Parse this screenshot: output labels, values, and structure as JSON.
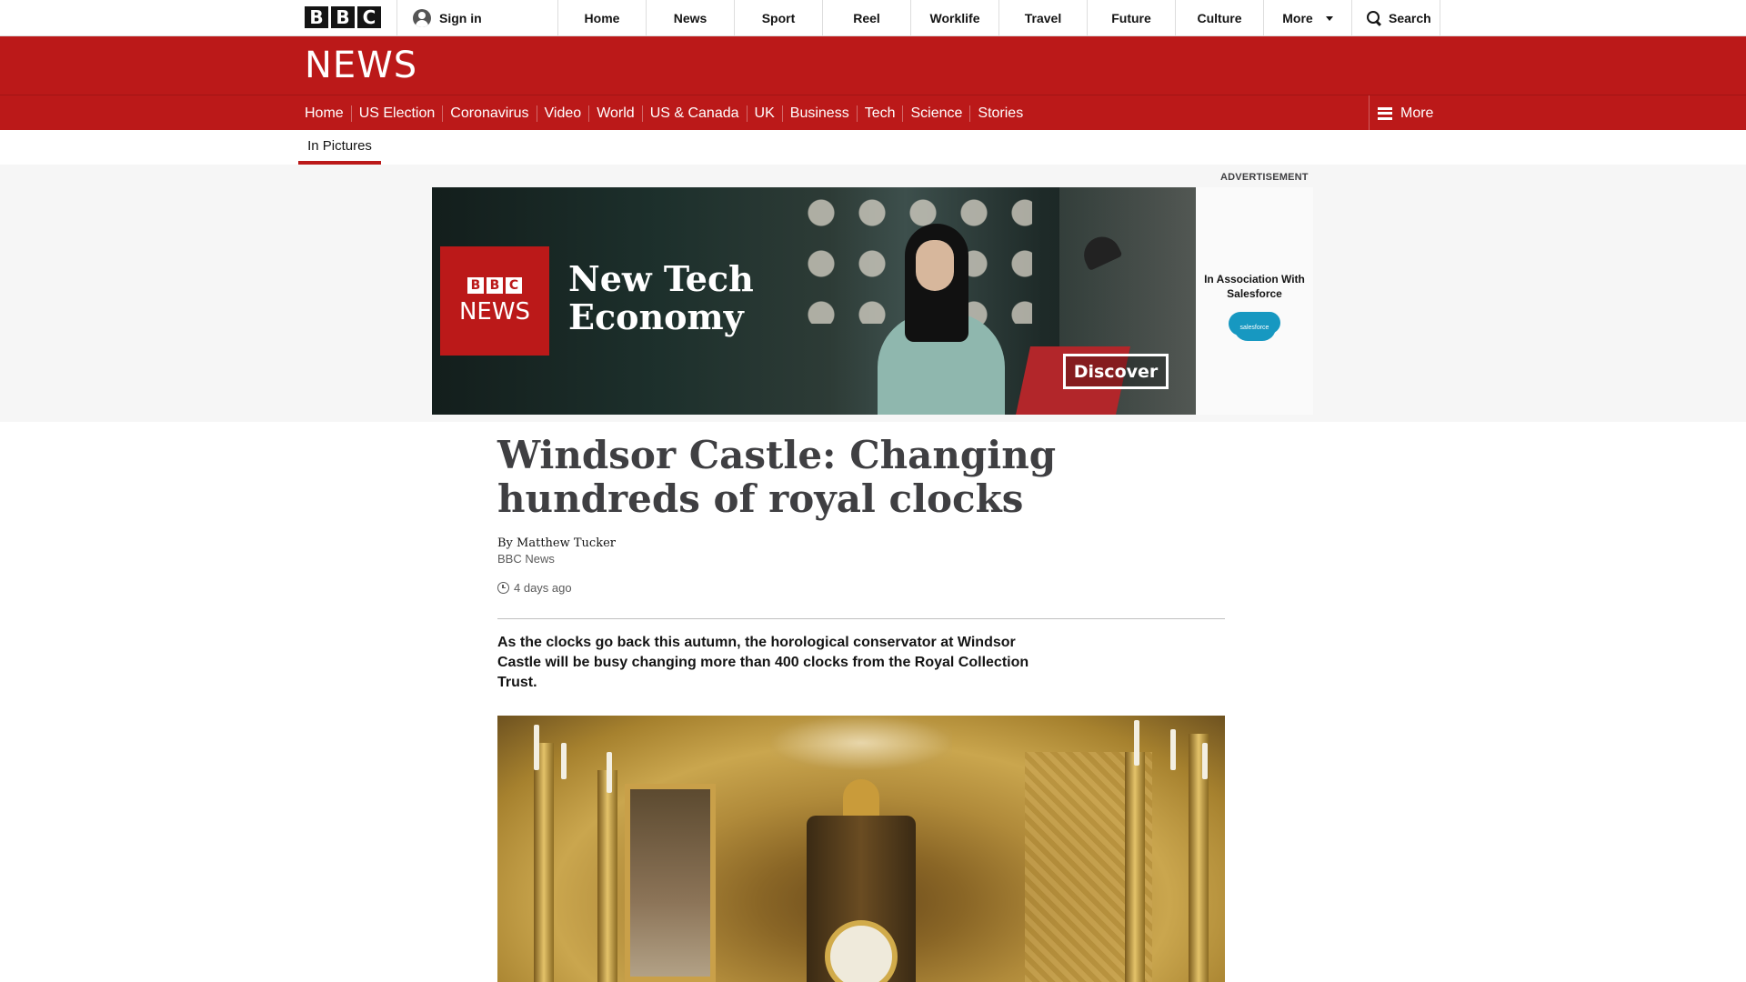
{
  "topbar": {
    "logo_letters": [
      "B",
      "B",
      "C"
    ],
    "signin_label": "Sign in",
    "nav": [
      "Home",
      "News",
      "Sport",
      "Reel",
      "Worklife",
      "Travel",
      "Future",
      "Culture"
    ],
    "more_label": "More",
    "search_label": "Search"
  },
  "news_band": {
    "wordmark": "NEWS"
  },
  "section_nav": {
    "items": [
      "Home",
      "US Election",
      "Coronavirus",
      "Video",
      "World",
      "US & Canada",
      "UK",
      "Business",
      "Tech",
      "Science",
      "Stories"
    ],
    "more_label": "More"
  },
  "sub_nav": {
    "active_tab": "In Pictures"
  },
  "advertisement": {
    "label": "ADVERTISEMENT",
    "mini_logo_letters": [
      "B",
      "B",
      "C"
    ],
    "mini_wordmark": "NEWS",
    "headline": "New Tech Economy",
    "cta": "Discover",
    "association": "In Association With Salesforce",
    "sponsor_logo_text": "salesforce"
  },
  "article": {
    "headline": "Windsor Castle: Changing hundreds of royal clocks",
    "author": "By Matthew Tucker",
    "organisation": "BBC News",
    "timestamp": "4 days ago",
    "intro": "As the clocks go back this autumn, the horological conservator at Windsor Castle will be busy changing more than 400 clocks from the Royal Collection Trust."
  },
  "colors": {
    "brand_red": "#bb1919",
    "headline_text": "#3f3f42"
  }
}
